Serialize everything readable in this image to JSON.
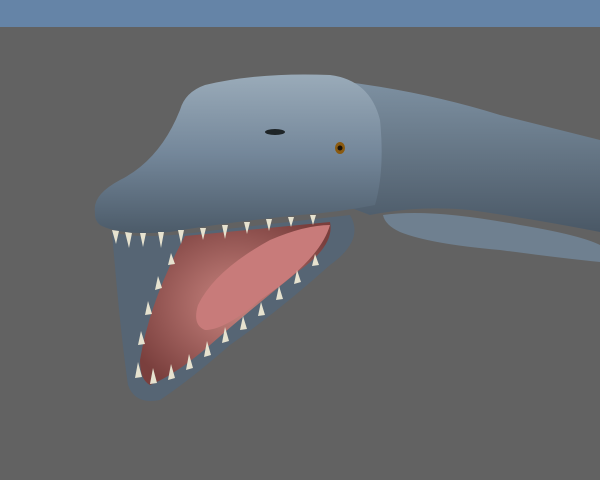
{
  "scene": {
    "colors": {
      "sky": "#6584a7",
      "background": "#626262",
      "skin": "#7d8fa0",
      "skin_dark": "#4f5e6c",
      "mouth": "#b9706c",
      "tongue": "#c87b7a",
      "teeth": "#e6e2cf",
      "eye": "#8a5a10"
    }
  }
}
